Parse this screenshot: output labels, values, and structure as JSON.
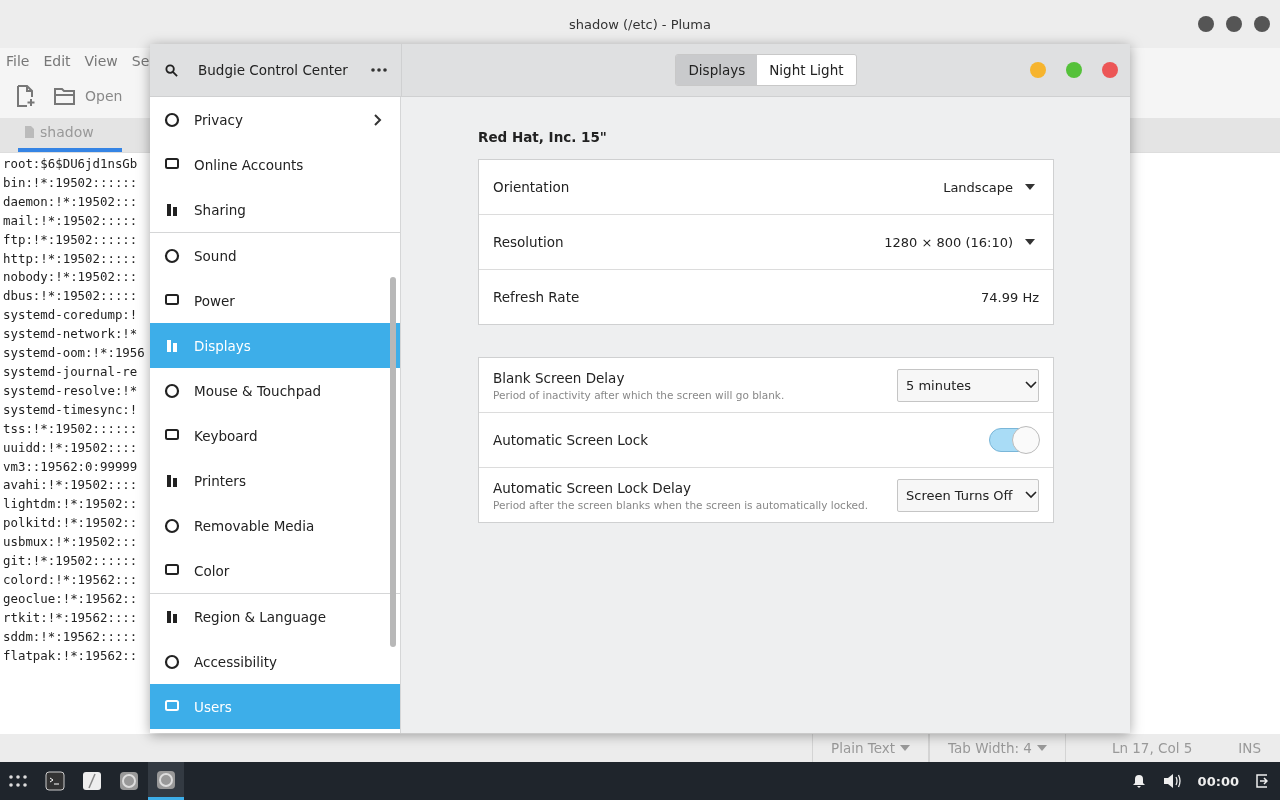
{
  "editor_window": {
    "title": "shadow (/etc) - Pluma",
    "menu": [
      "File",
      "Edit",
      "View",
      "Se"
    ],
    "toolbar": {
      "open_label": "Open"
    },
    "tab": {
      "label": "shadow"
    },
    "lines": [
      "root:$6$DU6jd1nsGb",
      "bin:!*:19502::::::",
      "daemon:!*:19502:::",
      "mail:!*:19502:::::",
      "ftp:!*:19502::::::",
      "http:!*:19502:::::",
      "nobody:!*:19502:::",
      "dbus:!*:19502:::::",
      "systemd-coredump:!",
      "systemd-network:!*",
      "systemd-oom:!*:1956",
      "systemd-journal-re",
      "systemd-resolve:!*",
      "systemd-timesync:!",
      "tss:!*:19502::::::",
      "uuidd:!*:19502::::",
      "vm3::19562:0:99999",
      "avahi:!*:19502::::",
      "lightdm:!*:19502::",
      "polkitd:!*:19502::",
      "usbmux:!*:19502:::",
      "git:!*:19502::::::",
      "colord:!*:19562:::",
      "geoclue:!*:19562::",
      "rtkit:!*:19562::::",
      "sddm:!*:19562:::::",
      "flatpak:!*:19562::"
    ],
    "status_bar": {
      "language": "Plain Text",
      "tab_width": "Tab Width:  4",
      "position": "Ln 17, Col 5",
      "mode": "INS"
    }
  },
  "settings_window": {
    "title": "Budgie Control Center",
    "view_tabs": [
      {
        "label": "Displays",
        "selected": true
      },
      {
        "label": "Night Light",
        "selected": false
      }
    ],
    "sidebar": [
      {
        "label": "Privacy",
        "selected": false,
        "separator_after": false
      },
      {
        "label": "Online Accounts",
        "selected": false,
        "separator_after": false
      },
      {
        "label": "Sharing",
        "selected": false,
        "separator_after": true
      },
      {
        "label": "Sound",
        "selected": false,
        "separator_after": false
      },
      {
        "label": "Power",
        "selected": false,
        "separator_after": false
      },
      {
        "label": "Displays",
        "selected": true,
        "separator_after": false
      },
      {
        "label": "Mouse & Touchpad",
        "selected": false,
        "separator_after": false
      },
      {
        "label": "Keyboard",
        "selected": false,
        "separator_after": false
      },
      {
        "label": "Printers",
        "selected": false,
        "separator_after": false
      },
      {
        "label": "Removable Media",
        "selected": false,
        "separator_after": false
      },
      {
        "label": "Color",
        "selected": false,
        "separator_after": true
      },
      {
        "label": "Region & Language",
        "selected": false,
        "separator_after": false
      },
      {
        "label": "Accessibility",
        "selected": false,
        "separator_after": false
      },
      {
        "label": "Users",
        "selected": true,
        "separator_after": false
      }
    ],
    "monitor_name": "Red Hat, Inc. 15\"",
    "groups": [
      [
        {
          "kind": "dropdown",
          "label": "Orientation",
          "value": "Landscape"
        },
        {
          "kind": "dropdown",
          "label": "Resolution",
          "value": "1280 × 800 (16:10)"
        },
        {
          "kind": "value",
          "label": "Refresh Rate",
          "value": "74.99 Hz"
        }
      ],
      [
        {
          "kind": "combo",
          "label": "Blank Screen Delay",
          "description": "Period of inactivity after which the screen will go blank.",
          "value": "5 minutes"
        },
        {
          "kind": "switch",
          "label": "Automatic Screen Lock",
          "on": true
        },
        {
          "kind": "combo",
          "label": "Automatic Screen Lock Delay",
          "description": "Period after the screen blanks when the screen is automatically locked.",
          "value": "Screen Turns Off"
        }
      ]
    ]
  },
  "taskbar": {
    "clock": "00:00"
  }
}
